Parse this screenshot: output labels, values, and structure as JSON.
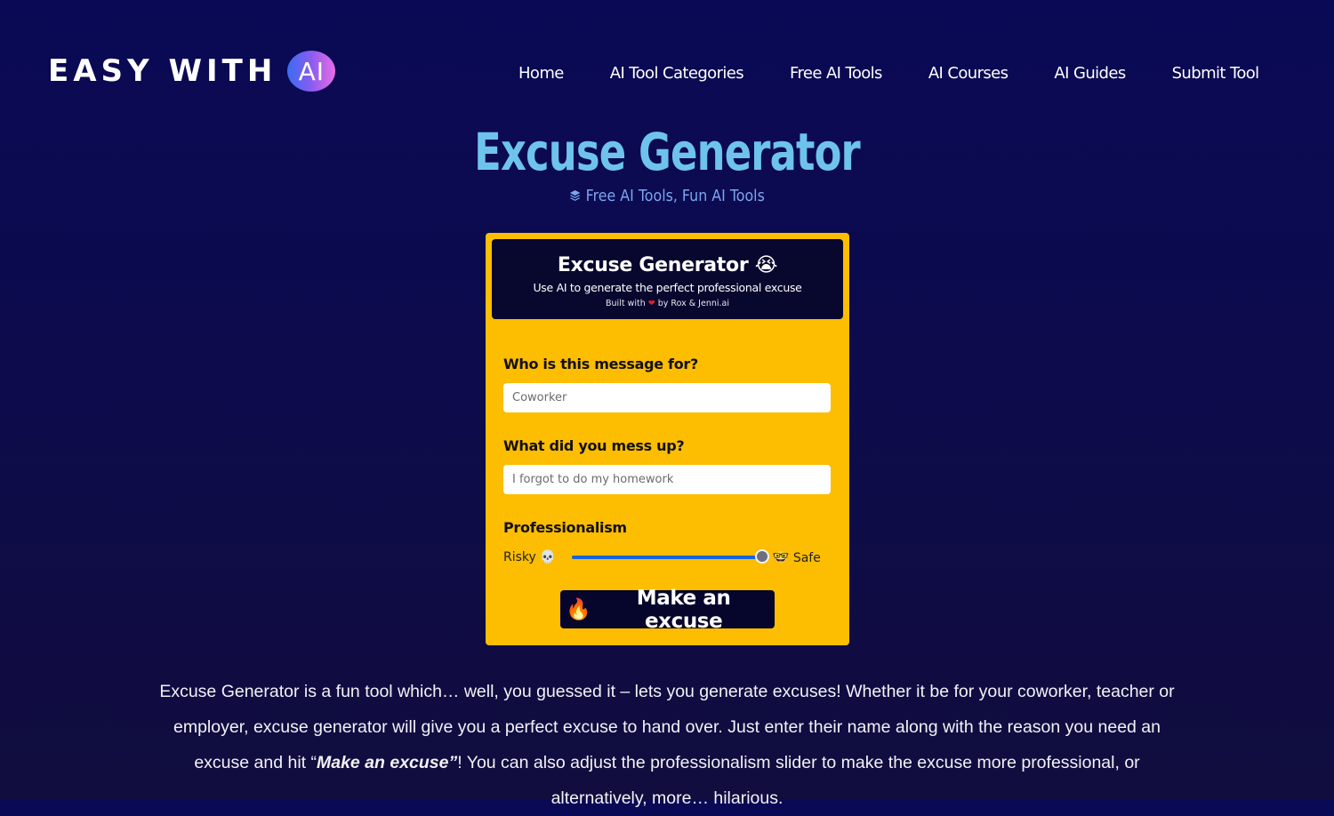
{
  "brand": {
    "logo_text": "EASY WITH",
    "logo_badge": "AI",
    "colors": {
      "background": "#0b0a50",
      "title": "#6ec3ec",
      "categories": "#7aa6f0",
      "tool_bg": "#fdbd00",
      "tool_header_bg": "#08072e",
      "slider": "#1a63d8"
    }
  },
  "nav": {
    "items": [
      {
        "label": "Home"
      },
      {
        "label": "AI Tool Categories"
      },
      {
        "label": "Free AI Tools"
      },
      {
        "label": "AI Courses"
      },
      {
        "label": "AI Guides"
      },
      {
        "label": "Submit Tool"
      }
    ]
  },
  "page": {
    "title": "Excuse Generator",
    "categories_icon": "layers-icon",
    "categories": "Free AI Tools, Fun AI Tools"
  },
  "tool": {
    "title": "Excuse Generator",
    "title_emoji": "😭",
    "subtitle": "Use AI to generate the perfect professional excuse",
    "built_prefix": "Built with",
    "built_heart": "❤",
    "built_suffix": "by Rox & Jenni.ai",
    "recipient": {
      "label": "Who is this message for?",
      "placeholder": "Coworker",
      "value": ""
    },
    "mistake": {
      "label": "What did you mess up?",
      "placeholder": "I forgot to do my homework",
      "value": ""
    },
    "professionalism": {
      "label": "Professionalism",
      "min_label": "Risky",
      "min_emoji": "💀",
      "max_emoji": "🤓",
      "max_label": "Safe",
      "value_percent": 100
    },
    "submit": {
      "emoji": "🔥",
      "label": "Make an excuse"
    }
  },
  "description": {
    "part1": "Excuse Generator is a fun tool which… well, you guessed it – lets you generate excuses! Whether it be for your coworker, teacher or employer, excuse generator will give you a perfect excuse to hand over. Just enter their name along with the reason you need an excuse and hit “",
    "emphasis": "Make an excuse”",
    "part2": "! You can also adjust the professionalism slider to make the excuse more professional, or alternatively, more… hilarious."
  }
}
